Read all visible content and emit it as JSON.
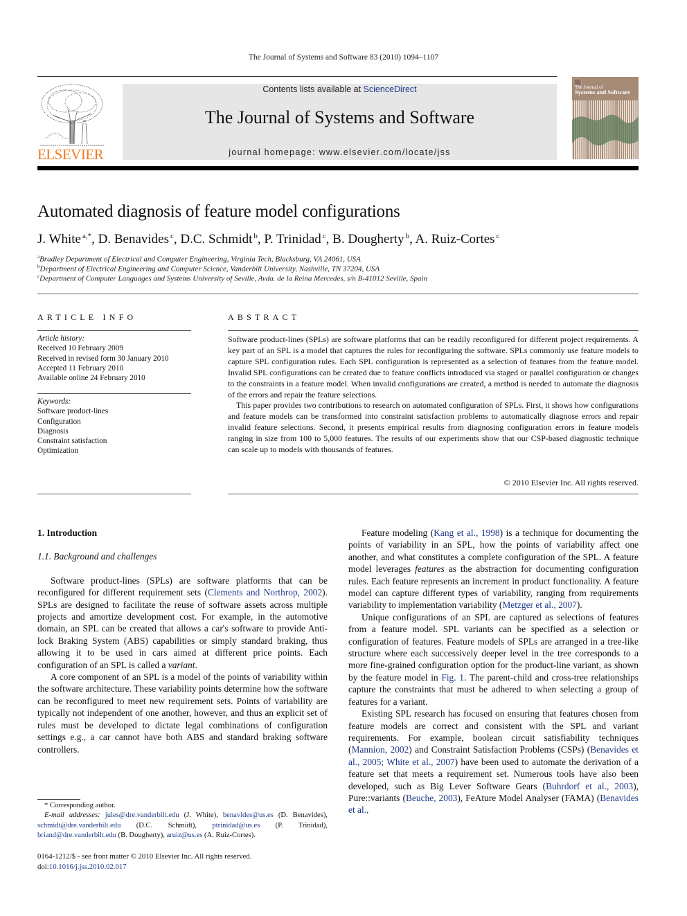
{
  "running_head": "The Journal of Systems and Software 83 (2010) 1094–1107",
  "masthead": {
    "contents_prefix": "Contents lists available at ",
    "contents_link": "ScienceDirect",
    "journal_name": "The Journal of Systems and Software",
    "homepage_prefix": "journal homepage: ",
    "homepage_url": "www.elsevier.com/locate/jss",
    "publisher_logo_text": "ELSEVIER",
    "cover_title_line1": "The Journal of",
    "cover_title_line2": "Systems and Software"
  },
  "colors": {
    "link": "#1f3a8a",
    "elsevier_orange": "#f2791f",
    "masthead_bg": "#e6e6e6",
    "cover_brown": "#a58a76",
    "cover_green": "#5d7a5a"
  },
  "article": {
    "title": "Automated diagnosis of feature model configurations",
    "authors": [
      {
        "name": "J. White",
        "sup": "a,*"
      },
      {
        "name": "D. Benavides",
        "sup": "c"
      },
      {
        "name": "D.C. Schmidt",
        "sup": "b"
      },
      {
        "name": "P. Trinidad",
        "sup": "c"
      },
      {
        "name": "B. Dougherty",
        "sup": "b"
      },
      {
        "name": "A. Ruiz-Cortes",
        "sup": "c"
      }
    ],
    "affiliations": [
      {
        "mark": "a",
        "text": "Bradley Department of Electrical and Computer Engineering, Virginia Tech, Blacksburg, VA 24061, USA"
      },
      {
        "mark": "b",
        "text": "Department of Electrical Engineering and Computer Science, Vanderbilt University, Nashville, TN 37204, USA"
      },
      {
        "mark": "c",
        "text": "Department of Computer Languages and Systems University of Seville, Avda. de la Reina Mercedes, s/n B-41012 Seville, Spain"
      }
    ]
  },
  "article_info": {
    "heading": "ARTICLE INFO",
    "history_label": "Article history:",
    "history": [
      "Received 10 February 2009",
      "Received in revised form 30 January 2010",
      "Accepted 11 February 2010",
      "Available online 24 February 2010"
    ],
    "keywords_label": "Keywords:",
    "keywords": [
      "Software product-lines",
      "Configuration",
      "Diagnosis",
      "Constraint satisfaction",
      "Optimization"
    ]
  },
  "abstract": {
    "heading": "ABSTRACT",
    "paragraphs": [
      "Software product-lines (SPLs) are software platforms that can be readily reconfigured for different project requirements. A key part of an SPL is a model that captures the rules for reconfiguring the software. SPLs commonly use feature models to capture SPL configuration rules. Each SPL configuration is represented as a selection of features from the feature model. Invalid SPL configurations can be created due to feature conflicts introduced via staged or parallel configuration or changes to the constraints in a feature model. When invalid configurations are created, a method is needed to automate the diagnosis of the errors and repair the feature selections.",
      "This paper provides two contributions to research on automated configuration of SPLs. First, it shows how configurations and feature models can be transformed into constraint satisfaction problems to automatically diagnose errors and repair invalid feature selections. Second, it presents empirical results from diagnosing configuration errors in feature models ranging in size from 100 to 5,000 features. The results of our experiments show that our CSP-based diagnostic technique can scale up to models with thousands of features."
    ],
    "copyright": "© 2010 Elsevier Inc. All rights reserved."
  },
  "body": {
    "section_heading": "1. Introduction",
    "subsection_heading": "1.1. Background and challenges",
    "left": {
      "p1_a": "Software product-lines (SPLs) are software platforms that can be reconfigured for different requirement sets (",
      "p1_cite": "Clements and Northrop, 2002",
      "p1_b": "). SPLs are designed to facilitate the reuse of software assets across multiple projects and amortize development cost. For example, in the automotive domain, an SPL can be created that allows a car's software to provide Anti-lock Braking System (ABS) capabilities or simply standard braking, thus allowing it to be used in cars aimed at different price points. Each configuration of an SPL is called a ",
      "p1_em": "variant",
      "p1_c": ".",
      "p2": "A core component of an SPL is a model of the points of variability within the software architecture. These variability points determine how the software can be reconfigured to meet new requirement sets. Points of variability are typically not independent of one another, however, and thus an explicit set of rules must be developed to dictate legal combinations of configuration settings e.g., a car cannot have both ABS and standard braking software controllers."
    },
    "right": {
      "p1_a": "Feature modeling (",
      "p1_cite1": "Kang et al., 1998",
      "p1_b": ") is a technique for documenting the points of variability in an SPL, how the points of variability affect one another, and what constitutes a complete configuration of the SPL. A feature model leverages ",
      "p1_em": "features",
      "p1_c": " as the abstraction for documenting configuration rules. Each feature represents an increment in product functionality. A feature model can capture different types of variability, ranging from requirements variability to implementation variability (",
      "p1_cite2": "Metzger et al., 2007",
      "p1_d": ").",
      "p2_a": "Unique configurations of an SPL are captured as selections of features from a feature model. SPL variants can be specified as a selection or configuration of features. Feature models of SPLs are arranged in a tree-like structure where each successively deeper level in the tree corresponds to a more fine-grained configuration option for the product-line variant, as shown by the feature model in ",
      "p2_fig": "Fig. 1",
      "p2_b": ". The parent-child and cross-tree relationships capture the constraints that must be adhered to when selecting a group of features for a variant.",
      "p3_a": "Existing SPL research has focused on ensuring that features chosen from feature models are correct and consistent with the SPL and variant requirements. For example, boolean circuit satisfiability techniques (",
      "p3_cite1": "Mannion, 2002",
      "p3_b": ") and Constraint Satisfaction Problems (CSPs) (",
      "p3_cite2": "Benavides et al., 2005; White et al., 2007",
      "p3_c": ") have been used to automate the derivation of a feature set that meets a requirement set. Numerous tools have also been developed, such as Big Lever Software Gears (",
      "p3_cite3": "Buhrdorf et al., 2003",
      "p3_d": "), Pure::variants (",
      "p3_cite4": "Beuche, 2003",
      "p3_e": "), FeAture Model Analyser (FAMA) (",
      "p3_cite5": "Benavides et al.,"
    }
  },
  "footnotes": {
    "corresponding": "* Corresponding author.",
    "email_label": "E-mail addresses:",
    "emails": [
      {
        "email": "jules@dre.vanderbilt.edu",
        "who": " (J. White), "
      },
      {
        "email": "benavides@us.es",
        "who": " (D. Benavides), "
      },
      {
        "email": "schmidt@dre.vanderbilt.edu",
        "who": " (D.C. Schmidt), "
      },
      {
        "email": "ptrinidad@us.es",
        "who": " (P. Trinidad), "
      },
      {
        "email": "briand@dre.vanderbilt.edu",
        "who": " (B. Dougherty), "
      },
      {
        "email": "aruiz@us.es",
        "who": " (A. Ruiz-Cortes)."
      }
    ],
    "front_matter": "0164-1212/$ - see front matter © 2010 Elsevier Inc. All rights reserved.",
    "doi_label": "doi:",
    "doi": "10.1016/j.jss.2010.02.017"
  }
}
